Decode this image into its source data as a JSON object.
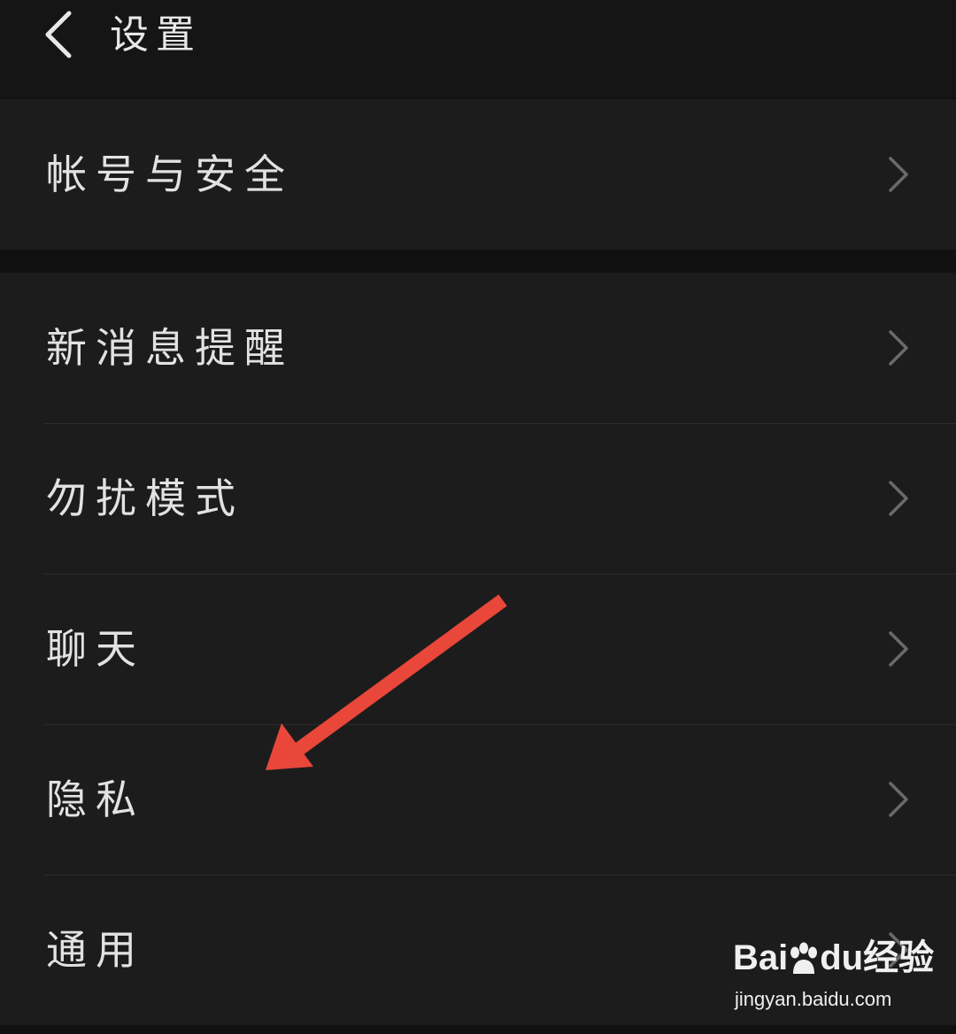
{
  "header": {
    "back_icon": "chevron-left-icon",
    "title": "设置"
  },
  "sections": [
    {
      "items": [
        {
          "label": "帐号与安全",
          "icon": "chevron-right-icon"
        }
      ]
    },
    {
      "items": [
        {
          "label": "新消息提醒",
          "icon": "chevron-right-icon"
        },
        {
          "label": "勿扰模式",
          "icon": "chevron-right-icon"
        },
        {
          "label": "聊天",
          "icon": "chevron-right-icon"
        },
        {
          "label": "隐私",
          "icon": "chevron-right-icon"
        },
        {
          "label": "通用",
          "icon": "chevron-right-icon"
        }
      ]
    }
  ],
  "annotation": {
    "icon": "red-arrow-icon",
    "color": "#e8473a"
  },
  "watermark": {
    "brand_left": "Bai",
    "brand_right": "du",
    "brand_cn": "经验",
    "url": "jingyan.baidu.com"
  },
  "colors": {
    "background": "#111111",
    "row_background": "#1c1c1c",
    "text": "#e2e2e2",
    "chevron": "#6a6a6a"
  }
}
